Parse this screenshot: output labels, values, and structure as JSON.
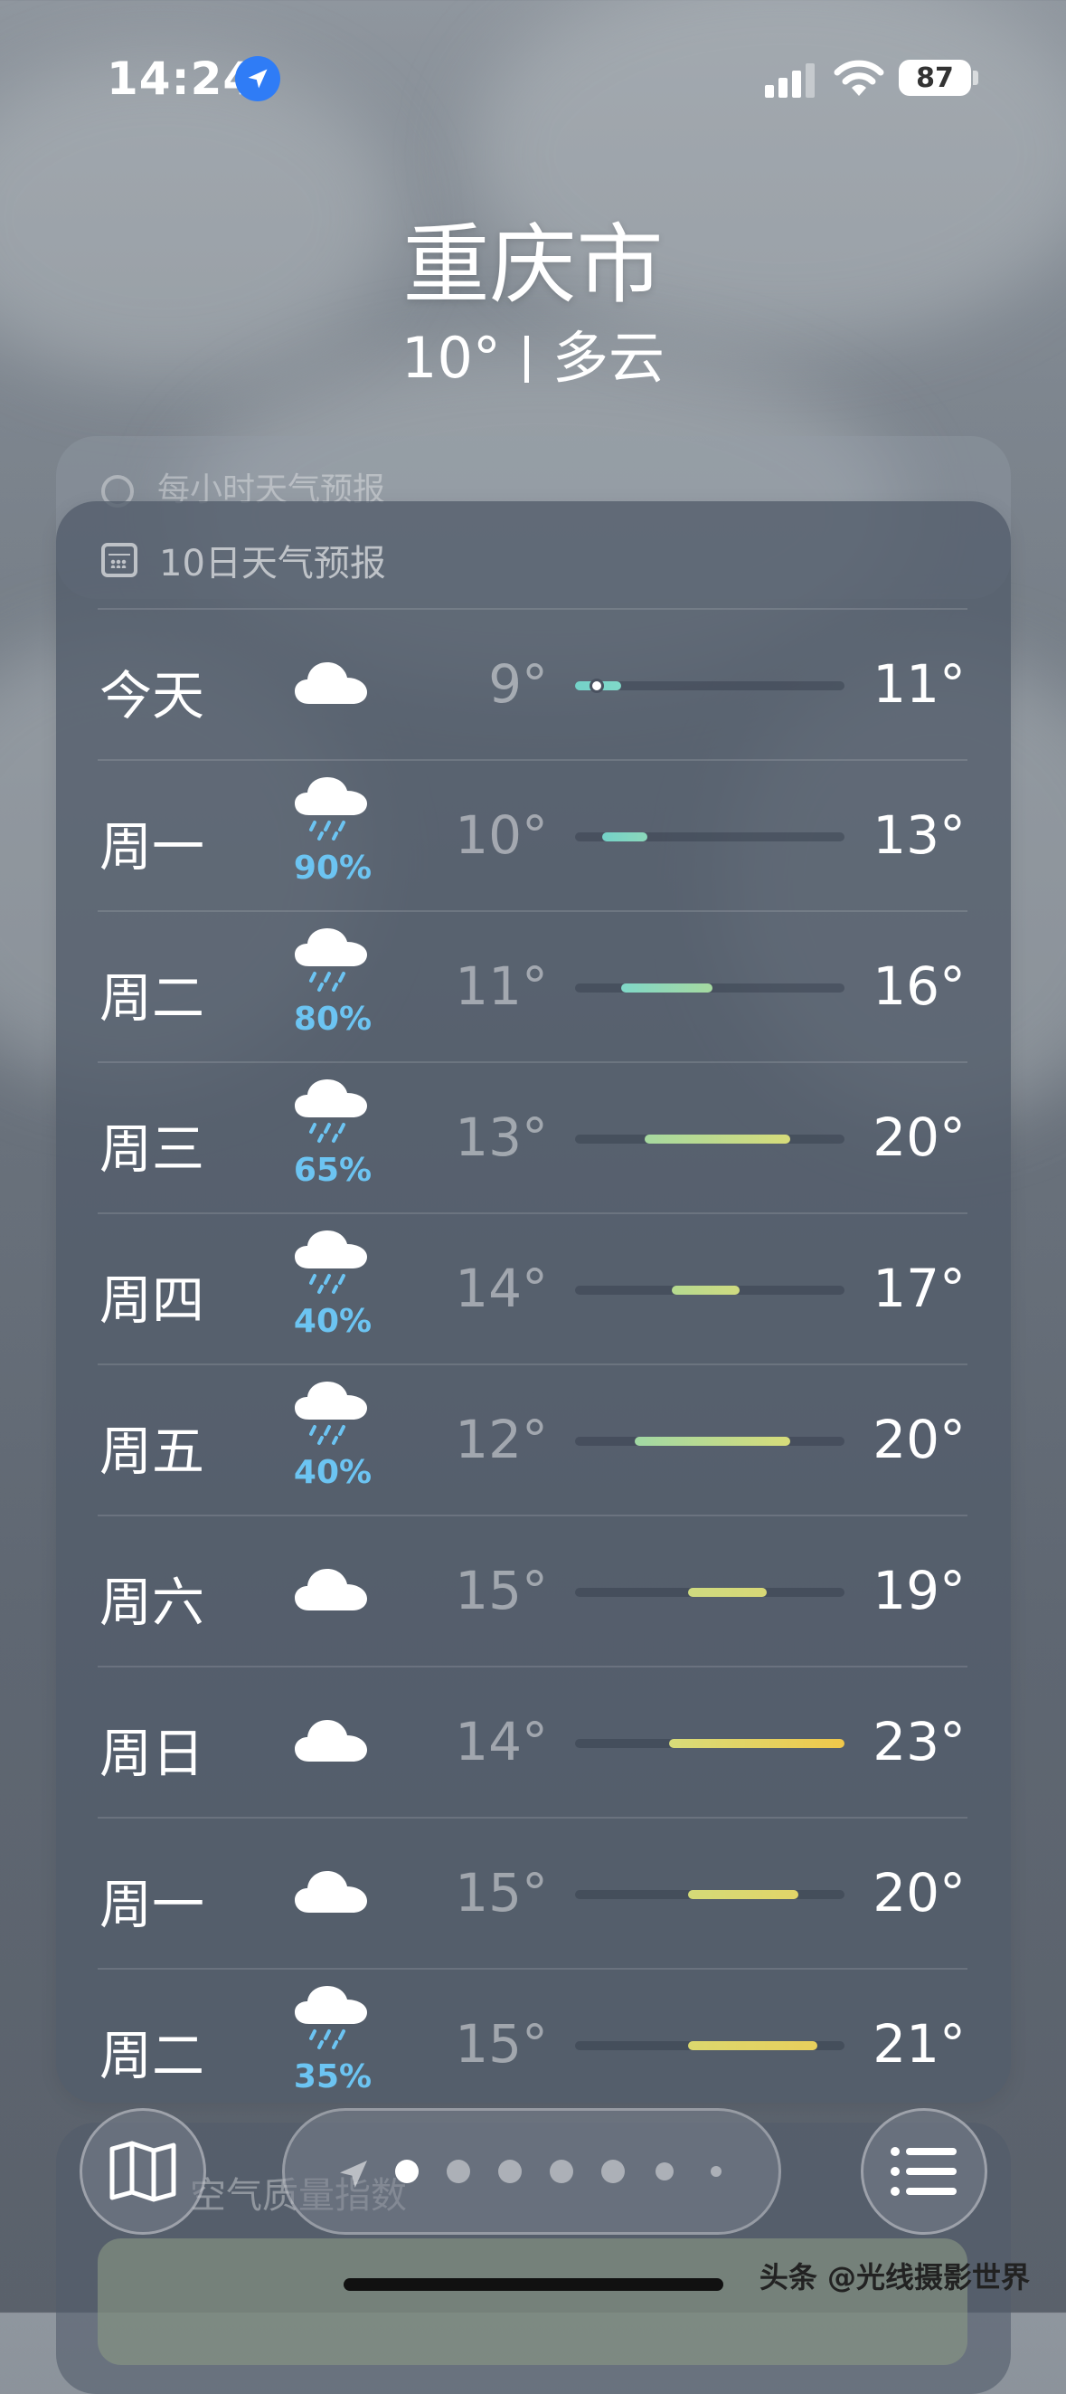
{
  "status_bar": {
    "time": "14:24",
    "battery": "87"
  },
  "location": {
    "city": "重庆市",
    "temperature": "10°",
    "condition": "多云"
  },
  "hourly_card": {
    "title": "每小时天气预报"
  },
  "forecast": {
    "title": "10日天气预报",
    "days": [
      {
        "day": "今天",
        "icon": "cloud-icon",
        "precip": "",
        "low": "9°",
        "high": "11°",
        "bar_start": 0.0,
        "bar_end": 0.17,
        "current_marker": 0.08,
        "color_from": "#74d2c8",
        "color_to": "#80d8c8"
      },
      {
        "day": "周一",
        "icon": "cloud-rain-icon",
        "precip": "90%",
        "low": "10°",
        "high": "13°",
        "bar_start": 0.1,
        "bar_end": 0.27,
        "color_from": "#74d2c8",
        "color_to": "#8bd8bb"
      },
      {
        "day": "周二",
        "icon": "cloud-rain-icon",
        "precip": "80%",
        "low": "11°",
        "high": "16°",
        "bar_start": 0.17,
        "bar_end": 0.51,
        "color_from": "#80d8c8",
        "color_to": "#a6d9a0"
      },
      {
        "day": "周三",
        "icon": "cloud-rain-icon",
        "precip": "65%",
        "low": "13°",
        "high": "20°",
        "bar_start": 0.26,
        "bar_end": 0.8,
        "color_from": "#a6d9a0",
        "color_to": "#d7dc7a"
      },
      {
        "day": "周四",
        "icon": "cloud-rain-icon",
        "precip": "40%",
        "low": "14°",
        "high": "17°",
        "bar_start": 0.36,
        "bar_end": 0.61,
        "color_from": "#b5da90",
        "color_to": "#cfdb80"
      },
      {
        "day": "周五",
        "icon": "cloud-rain-icon",
        "precip": "40%",
        "low": "12°",
        "high": "20°",
        "bar_start": 0.22,
        "bar_end": 0.8,
        "color_from": "#a1d8a4",
        "color_to": "#d7dc7a"
      },
      {
        "day": "周六",
        "icon": "cloud-icon",
        "precip": "",
        "low": "15°",
        "high": "19°",
        "bar_start": 0.42,
        "bar_end": 0.71,
        "color_from": "#cfdb80",
        "color_to": "#d8d876"
      },
      {
        "day": "周日",
        "icon": "cloud-icon",
        "precip": "",
        "low": "14°",
        "high": "23°",
        "bar_start": 0.35,
        "bar_end": 1.0,
        "color_from": "#d8dc7a",
        "color_to": "#f0c84a"
      },
      {
        "day": "周一",
        "icon": "cloud-icon",
        "precip": "",
        "low": "15°",
        "high": "20°",
        "bar_start": 0.42,
        "bar_end": 0.83,
        "color_from": "#d4db78",
        "color_to": "#e2d468"
      },
      {
        "day": "周二",
        "icon": "cloud-rain-icon",
        "precip": "35%",
        "low": "15°",
        "high": "21°",
        "bar_start": 0.42,
        "bar_end": 0.9,
        "color_from": "#dcd86e",
        "color_to": "#e8cf5c"
      }
    ]
  },
  "air_quality": {
    "title": "空气质量指数"
  },
  "pager": {
    "page_count": 7,
    "active_index": 1
  },
  "watermark": "头条 @光线摄影世界"
}
